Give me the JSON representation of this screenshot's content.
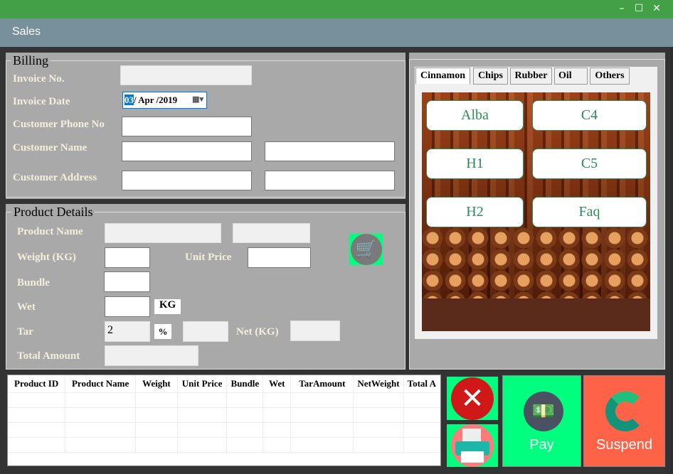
{
  "window": {
    "title": "Sales",
    "controls": [
      "minimize",
      "maximize",
      "close"
    ]
  },
  "billing": {
    "title": "Billing",
    "invoice_no_label": "Invoice No.",
    "invoice_no": "",
    "invoice_date_label": "Invoice Date",
    "date_day": "03",
    "date_rest": "/ Apr /2019",
    "phone_label": "Customer Phone No",
    "name_label": "Customer Name",
    "address_label": "Customer Address"
  },
  "product": {
    "title": "Product Details",
    "name_label": "Product Name",
    "weight_label": "Weight (KG)",
    "unit_price_label": "Unit Price",
    "bundle_label": "Bundle",
    "wet_label": "Wet",
    "wet_unit": "KG",
    "tar_label": "Tar",
    "tar_value": "2",
    "tar_unit": "%",
    "net_label": "Net (KG)",
    "total_label": "Total Amount"
  },
  "tabs": [
    "Cinnamon",
    "Chips",
    "Rubber",
    "Oil",
    "Others"
  ],
  "active_tab": "Cinnamon",
  "grades": [
    "Alba",
    "C4",
    "H1",
    "C5",
    "H2",
    "Faq"
  ],
  "table": {
    "columns": [
      "Product ID",
      "Product Name",
      "Weight",
      "Unit Price",
      "Bundle",
      "Wet",
      "TarAmount",
      "NetWeight",
      "Total A"
    ],
    "rows": []
  },
  "actions": {
    "pay": "Pay",
    "suspend": "Suspend"
  },
  "colors": {
    "titlebar": "#43a047",
    "header": "#78909c",
    "accent_green": "#00ff7f",
    "suspend": "#ff6347"
  }
}
